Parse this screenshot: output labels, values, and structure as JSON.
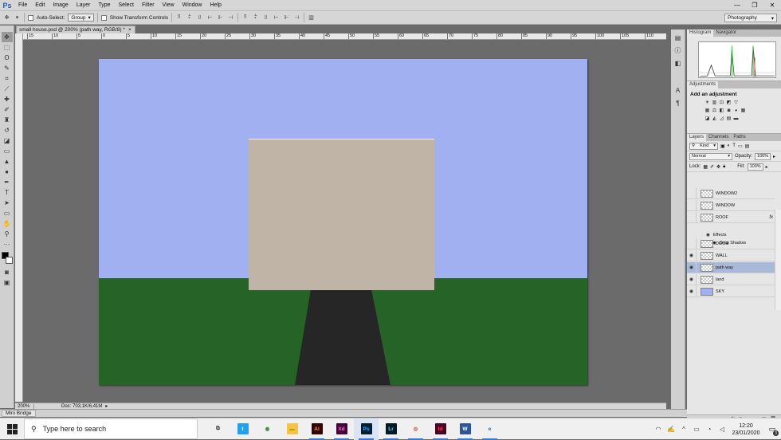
{
  "app": {
    "logo_text": "Ps"
  },
  "menu": [
    "File",
    "Edit",
    "Image",
    "Layer",
    "Type",
    "Select",
    "Filter",
    "View",
    "Window",
    "Help"
  ],
  "window_controls": {
    "minimize": "—",
    "maximize": "❐",
    "close": "✕"
  },
  "options": {
    "auto_select_label": "Auto-Select:",
    "group_value": "Group",
    "transform_label": "Show Transform Controls",
    "workspace": "Photography"
  },
  "document": {
    "tab_title": "small house.psd @ 200% (path way, RGB/8) *",
    "close": "×",
    "zoom": "200%",
    "doc_size": "Doc: 703,1K/6,41M"
  },
  "ruler_ticks": [
    "15",
    "10",
    "5",
    "0",
    "5",
    "10",
    "15",
    "20",
    "25",
    "30",
    "35",
    "40",
    "45",
    "50",
    "55",
    "60",
    "65",
    "70",
    "75",
    "80",
    "85",
    "90",
    "95",
    "100",
    "105",
    "110"
  ],
  "mini_bridge": "Mini Bridge",
  "panels": {
    "histogram_tab": "Histogram",
    "navigator_tab": "Navigator",
    "adjustments_tab": "Adjustments",
    "add_adjustment": "Add an adjustment",
    "layers_tab": "Layers",
    "channels_tab": "Channels",
    "paths_tab": "Paths",
    "kind": "Kind",
    "blend_mode": "Normal",
    "opacity_label": "Opacity:",
    "opacity": "100%",
    "lock_label": "Lock:",
    "fill_label": "Fill:",
    "fill": "100%"
  },
  "layers": [
    {
      "name": "WINDOW2",
      "visible": false,
      "selected": false
    },
    {
      "name": "WINDOW",
      "visible": false,
      "selected": false
    },
    {
      "name": "ROOF",
      "visible": false,
      "selected": false,
      "fx": "fx"
    },
    {
      "name": "DOOR",
      "visible": false,
      "selected": false
    },
    {
      "name": "WALL",
      "visible": true,
      "selected": false
    },
    {
      "name": "path way",
      "visible": true,
      "selected": true
    },
    {
      "name": "land",
      "visible": true,
      "selected": false
    },
    {
      "name": "SKY",
      "visible": true,
      "selected": false
    }
  ],
  "effects": {
    "label": "Effects",
    "drop_shadow": "Drop Shadow"
  },
  "canvas_colors": {
    "sky": "#a0b0f0",
    "land": "#256326",
    "path": "#262626",
    "wall": "#bfb4a5"
  },
  "taskbar": {
    "search_placeholder": "Type here to search",
    "apps": [
      {
        "name": "task-view",
        "label": "⧉",
        "bg": "transparent",
        "fg": "#333"
      },
      {
        "name": "twitter",
        "label": "t",
        "bg": "#1da1f2",
        "fg": "#fff"
      },
      {
        "name": "maps",
        "label": "◉",
        "bg": "transparent",
        "fg": "#3d8f3d"
      },
      {
        "name": "file-explorer",
        "label": "▬",
        "bg": "#f5c542",
        "fg": "#c8961e"
      },
      {
        "name": "illustrator",
        "label": "Ai",
        "bg": "#330000",
        "fg": "#ff9a00"
      },
      {
        "name": "xd",
        "label": "Xd",
        "bg": "#470137",
        "fg": "#ff61f6"
      },
      {
        "name": "photoshop",
        "label": "Ps",
        "bg": "#001e36",
        "fg": "#31a8ff"
      },
      {
        "name": "lightroom",
        "label": "Lr",
        "bg": "#001a26",
        "fg": "#74c9f3"
      },
      {
        "name": "chrome",
        "label": "◎",
        "bg": "transparent",
        "fg": "#db4437"
      },
      {
        "name": "indesign",
        "label": "Id",
        "bg": "#49021f",
        "fg": "#ff3366"
      },
      {
        "name": "word",
        "label": "W",
        "bg": "#2b579a",
        "fg": "#fff"
      },
      {
        "name": "edge",
        "label": "e",
        "bg": "transparent",
        "fg": "#0078d7"
      }
    ],
    "time": "12:20",
    "date": "23/01/2020",
    "notifications": "3"
  }
}
